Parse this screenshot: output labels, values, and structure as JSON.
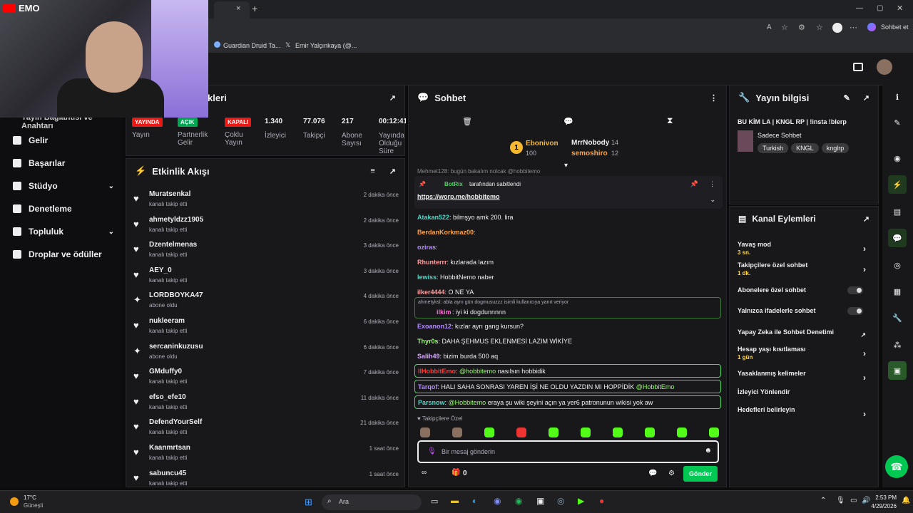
{
  "browser": {
    "tab_close": "×",
    "new_tab": "+",
    "bookmarks": [
      "Guardian Druid Ta...",
      "Emir Yalçınkaya (@..."
    ],
    "chat_button": "Sohbet et"
  },
  "webcam": {
    "brand": "EMO"
  },
  "sidebar": {
    "partial_label": "Yayın Bağlantısı ve Anahtarı",
    "items": [
      {
        "label": "Gelir"
      },
      {
        "label": "Başarılar"
      },
      {
        "label": "Stüdyo"
      },
      {
        "label": "Denetleme"
      },
      {
        "label": "Topluluk"
      },
      {
        "label": "Droplar ve ödüller"
      }
    ]
  },
  "stats": {
    "title": "kleri",
    "badges": {
      "live": "YAYINDA",
      "open": "AÇIK",
      "closed": "KAPALI"
    },
    "labels": {
      "stream": "Yayın",
      "partner": "Partnerlik Gelir",
      "multi": "Çoklu Yayın",
      "viewers": "İzleyici",
      "followers": "Takipçi",
      "subs": "Abone Sayısı",
      "uptime": "Yayında Olduğu Süre"
    },
    "values": {
      "viewers": "1.340",
      "followers": "77.076",
      "subs": "217",
      "uptime": "00:12:41"
    }
  },
  "activity": {
    "title": "Etkinlik Akışı",
    "items": [
      {
        "name": "Muratsenkal",
        "sub": "kanalı takip etti",
        "time": "2 dakika önce",
        "icon": "heart"
      },
      {
        "name": "ahmetyldzz1905",
        "sub": "kanalı takip etti",
        "time": "2 dakika önce",
        "icon": "heart"
      },
      {
        "name": "Dzentelmenas",
        "sub": "kanalı takip etti",
        "time": "3 dakika önce",
        "icon": "heart"
      },
      {
        "name": "AEY_0",
        "sub": "kanalı takip etti",
        "time": "3 dakika önce",
        "icon": "heart"
      },
      {
        "name": "LORDBOYKA47",
        "sub": "abone oldu",
        "time": "4 dakika önce",
        "icon": "star"
      },
      {
        "name": "nukleeram",
        "sub": "kanalı takip etti",
        "time": "6 dakika önce",
        "icon": "heart"
      },
      {
        "name": "sercaninkuzusu",
        "sub": "abone oldu",
        "time": "6 dakika önce",
        "icon": "star"
      },
      {
        "name": "GMduffy0",
        "sub": "kanalı takip etti",
        "time": "7 dakika önce",
        "icon": "heart"
      },
      {
        "name": "efso_efe10",
        "sub": "kanalı takip etti",
        "time": "11 dakika önce",
        "icon": "heart"
      },
      {
        "name": "DefendYourSelf",
        "sub": "kanalı takip etti",
        "time": "21 dakika önce",
        "icon": "heart"
      },
      {
        "name": "Kaanmrtsan",
        "sub": "kanalı takip etti",
        "time": "1 saat önce",
        "icon": "heart"
      },
      {
        "name": "sabuncu45",
        "sub": "kanalı takip etti",
        "time": "1 saat önce",
        "icon": "heart"
      }
    ]
  },
  "chat": {
    "title": "Sohbet",
    "leaderboard": {
      "first": {
        "name": "Ebonivon",
        "points": "100"
      },
      "second": {
        "name": "MrrNobody",
        "points": "14"
      },
      "third": {
        "name": "semoshiro",
        "points": "12"
      }
    },
    "partial_top": "Mehmet128: bugün bakalım nolcak @hobbitemo",
    "pinned": {
      "by": "BotRix",
      "by_text": "tarafından sabitlendi",
      "link": "https://worp.me/hobbitemo"
    },
    "messages": [
      {
        "user": "Atakan522",
        "text": ": bilmşyo amk 200. lira",
        "color": "#4bd8c8"
      },
      {
        "user": "BerdanKorkmaz00",
        "text": ":",
        "color": "#ffa23e"
      },
      {
        "user": "oziras",
        "text": ":",
        "color": "#b48cff"
      },
      {
        "user": "Rhunterrr",
        "text": ": kızlarada lazım",
        "color": "#ff9e9e"
      },
      {
        "user": "lewiss",
        "text": ": HobbitNemo naber",
        "color": "#4bd8c8"
      },
      {
        "user": "ilker4444",
        "text": ": O NE YA",
        "color": "#ff9e9e"
      }
    ],
    "reply": {
      "context": "ahmetyksl: abla aynı gün dogmusuzzz isimli kullanıcıya yanıt veriyor",
      "user": "ilkim",
      "text": ": iyi ki dogdunnnnn"
    },
    "messages2": [
      {
        "user": "Exoanon12",
        "text": ": kızlar ayrı gang kursun?",
        "color": "#b48cff"
      },
      {
        "user": "Thyr0s",
        "text": ": DAHA ŞEHMUS EKLENMESİ LAZIM WİKİYE",
        "color": "#9bff6b"
      },
      {
        "user": "Salih49",
        "text": ": bizim burda 500 aq",
        "color": "#d9a8ff"
      }
    ],
    "highlighted": [
      {
        "user": "llHobbitEmo",
        "mention": "@hobbitemo",
        "text": "nasılsın hobbidik",
        "color": "#ff3b3b"
      },
      {
        "user": "Tarqof",
        "mention": "",
        "text": ": HALI SAHA SONRASI YAREN İŞİ NE OLDU YAZDIN MI HOPPİDİK",
        "mention2": "@HobbitEmo",
        "color": "#b48cff"
      },
      {
        "user": "Parsnow",
        "mention": "@Hobbitemo",
        "text": "eraya şu wiki şeyini açın ya yer6 patronunun wikisi yok aw",
        "color": "#4bd8c8"
      }
    ],
    "emote_label": "Takipçilere Özel",
    "input_placeholder": "Bir mesaj gönderin",
    "gift_count": "0",
    "send_label": "Gönder"
  },
  "info": {
    "title": "Yayın bilgisi",
    "stream_title": "BU KİM LA | KNGL RP | !insta !blerp",
    "category": "Sadece Sohbet",
    "tags": [
      "Turkish",
      "KNGL",
      "knglrp"
    ]
  },
  "channel_actions": {
    "title": "Kanal Eylemleri",
    "items": [
      {
        "label": "Yavaş mod",
        "sub": "3 sn.",
        "control": "chevron"
      },
      {
        "label": "Takipçilere özel sohbet",
        "sub": "1 dk.",
        "control": "chevron"
      },
      {
        "label": "Abonelere özel sohbet",
        "sub": "",
        "control": "toggle"
      },
      {
        "label": "Yalnızca ifadelerle sohbet",
        "sub": "",
        "control": "toggle"
      },
      {
        "label": "Yapay Zeka ile Sohbet Denetimi",
        "sub": "",
        "control": "external"
      },
      {
        "label": "Hesap yaşı kısıtlaması",
        "sub": "1 gün",
        "control": "chevron"
      },
      {
        "label": "Yasaklanmış kelimeler",
        "sub": "",
        "control": "chevron"
      },
      {
        "label": "İzleyici Yönlendir",
        "sub": "",
        "control": "none"
      },
      {
        "label": "Hedefleri belirleyin",
        "sub": "",
        "control": "chevron"
      }
    ]
  },
  "taskbar": {
    "weather_temp": "17°C",
    "weather_desc": "Güneşli",
    "search": "Ara",
    "time": "2:53 PM",
    "date": "4/29/2026"
  },
  "colors": {
    "accent": "#53fc18",
    "send": "#00c853",
    "live": "#e91916"
  }
}
